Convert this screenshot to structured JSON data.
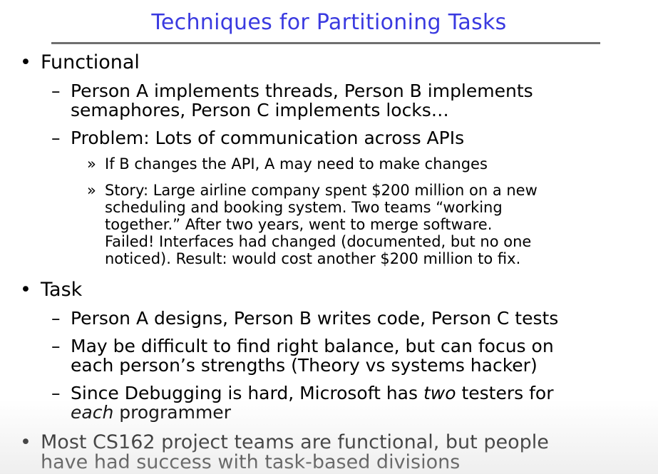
{
  "title": "Techniques for Partitioning Tasks",
  "bullet_marker": "•",
  "sub_marker": "–",
  "subsub_marker": "»",
  "functional": {
    "heading": "Functional",
    "item1": [
      "Person A implements threads, Person B implements",
      "semaphores, Person C implements locks…"
    ],
    "item2": "Problem: Lots of communication across APIs",
    "sub1": "If B changes the API, A may need to make changes",
    "sub2": [
      "Story: Large airline company spent $200 million on a new",
      "scheduling and booking system. Two teams “working",
      "together.” After two years, went to merge software.",
      "Failed! Interfaces had changed (documented, but no one",
      "noticed). Result: would cost another $200 million to fix."
    ]
  },
  "task": {
    "heading": "Task",
    "item1": "Person A designs, Person B writes code, Person C tests",
    "item2": [
      "May be difficult to find right balance, but can focus on",
      "each person’s strengths (Theory vs systems hacker)"
    ],
    "item3": {
      "line1_before": "Since Debugging is hard, Microsoft has ",
      "line1_em": "two",
      "line1_after": " testers for",
      "line2_em": "each",
      "line2_after": " programmer"
    }
  },
  "last_bullet": [
    "Most CS162 project teams are functional, but people",
    "have had success with task-based divisions"
  ]
}
